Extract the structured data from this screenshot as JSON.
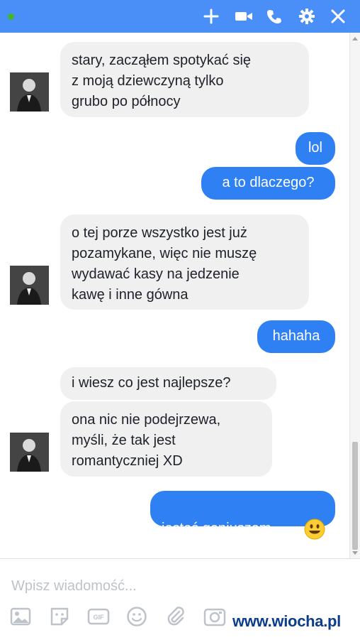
{
  "header": {
    "title": "",
    "icons": [
      "add-icon",
      "video-call-icon",
      "phone-icon",
      "gear-icon",
      "close-icon"
    ]
  },
  "messages": [
    {
      "side": "left",
      "text": "stary, zacząłem spotykać się\nz moją dziewczyną tylko\ngrubo po północy"
    },
    {
      "side": "right",
      "text": "lol"
    },
    {
      "side": "right",
      "text": "a to dlaczego?"
    },
    {
      "side": "left",
      "text": "o tej porze wszystko jest już\npozamykane, więc nie muszę\nwydawać kasy na jedzenie\nkawę i inne gówna"
    },
    {
      "side": "right",
      "text": "hahaha"
    },
    {
      "side": "left",
      "text": "i wiesz co jest najlepsze?"
    },
    {
      "side": "left",
      "text": "ona nic nie podejrzewa,\nmyśli, że tak jest\nromantyczniej XD"
    },
    {
      "side": "right",
      "text": "jesteś geniuszem"
    }
  ],
  "composer": {
    "placeholder": "Wpisz wiadomość...",
    "tools": [
      "image-icon",
      "sticker-icon",
      "gif-icon",
      "emoji-icon",
      "attachment-icon",
      "camera-icon"
    ]
  },
  "watermark": "www.wiocha.pl"
}
